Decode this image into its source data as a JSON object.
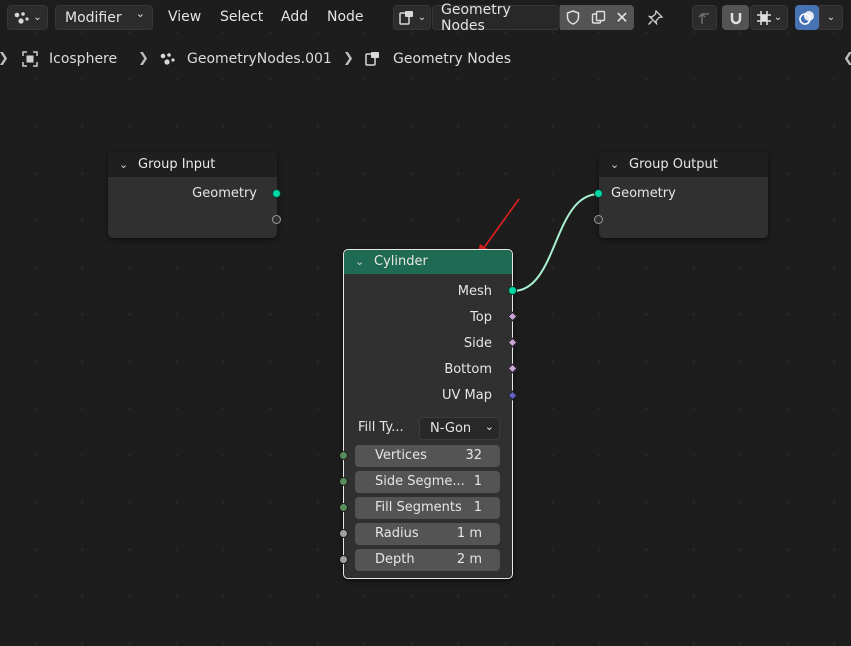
{
  "header": {
    "editor_type_icon": "node-editor-icon",
    "modifier_menu": "Modifier",
    "menus": [
      "View",
      "Select",
      "Add",
      "Node"
    ],
    "tree_type_icon": "geometry-nodes-icon",
    "datablock_name": "Geometry Nodes",
    "pin_icon": "pin-icon"
  },
  "breadcrumb": {
    "object": "Icosphere",
    "modifier": "GeometryNodes.001",
    "tree": "Geometry Nodes"
  },
  "nodes": {
    "group_input": {
      "title": "Group Input",
      "output": "Geometry"
    },
    "group_output": {
      "title": "Group Output",
      "input": "Geometry"
    },
    "cylinder": {
      "title": "Cylinder",
      "header_color": "#1e6a52",
      "outputs": [
        "Mesh",
        "Top",
        "Side",
        "Bottom",
        "UV Map"
      ],
      "fill_type_label": "Fill Ty...",
      "fill_type_value": "N-Gon",
      "inputs": [
        {
          "label": "Vertices",
          "value": "32"
        },
        {
          "label": "Side Segme...",
          "value": "1"
        },
        {
          "label": "Fill Segments",
          "value": "1"
        },
        {
          "label": "Radius",
          "value": "1 m"
        },
        {
          "label": "Depth",
          "value": "2 m"
        }
      ]
    }
  },
  "colors": {
    "geometry_socket": "#00d6a3",
    "bool_socket": "#cca6d6",
    "vector_socket": "#6363c7",
    "int_socket": "#598c5c",
    "float_socket": "#a1a1a1",
    "link": "#a8f0d0",
    "annotation_arrow": "#e02020",
    "accent": "#4772b3"
  }
}
